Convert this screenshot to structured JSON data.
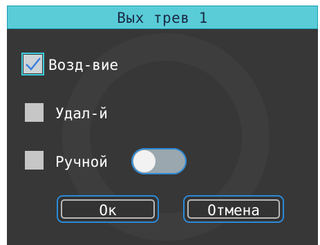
{
  "dialog": {
    "title": "Вых трев 1",
    "options": [
      {
        "label": "Возд-вие",
        "checked": true
      },
      {
        "label": "Удал-й",
        "checked": false
      },
      {
        "label": "Ручной",
        "checked": false
      }
    ],
    "manual_toggle": {
      "state": "off"
    },
    "ok_label": "Ок",
    "cancel_label": "Отмена"
  },
  "colors": {
    "background": "#373737",
    "title_bar": "#59ccd8",
    "focus_border": "#2c8ad8",
    "checkbox_focus": "#3ed2e2"
  },
  "icons": {
    "checkmark": "check-icon"
  }
}
